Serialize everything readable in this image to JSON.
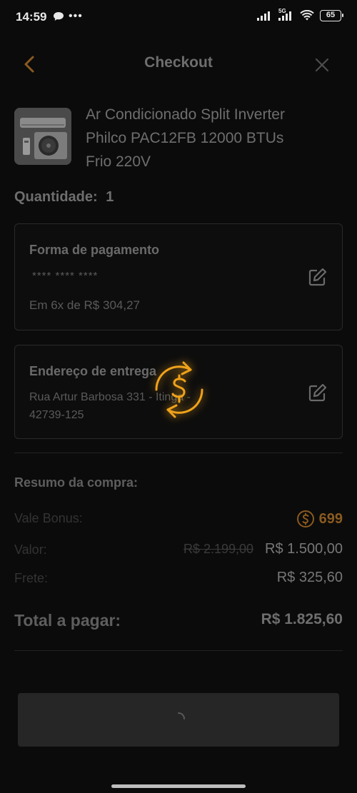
{
  "status_bar": {
    "time": "14:59",
    "network": "5G",
    "battery": "65"
  },
  "header": {
    "title": "Checkout",
    "back_icon": "chevron-left-icon",
    "close_icon": "close-icon"
  },
  "product": {
    "name_line1": "Ar Condicionado Split Inverter",
    "name_line2": "Philco PAC12FB 12000 BTUs",
    "name_line3": "Frio 220V"
  },
  "quantity": {
    "label": "Quantidade:",
    "value": "1"
  },
  "payment": {
    "title": "Forma de pagamento",
    "card_mask": "**** **** ****",
    "installments": "Em 6x de R$ 304,27"
  },
  "address": {
    "title": "Endereço de entrega",
    "line1": "Rua Artur Barbosa 331 - Itinga -",
    "line2": "42739-125"
  },
  "summary": {
    "title": "Resumo da compra:",
    "bonus_label": "Vale Bonus:",
    "bonus_value": "699",
    "price_label": "Valor:",
    "price_old": "R$ 2.199,00",
    "price_new": "R$ 1.500,00",
    "shipping_label": "Frete:",
    "shipping_value": "R$ 325,60",
    "total_label": "Total a pagar:",
    "total_value": "R$ 1.825,60"
  },
  "colors": {
    "accent": "#f0a21a",
    "background": "#0b0b0b"
  }
}
